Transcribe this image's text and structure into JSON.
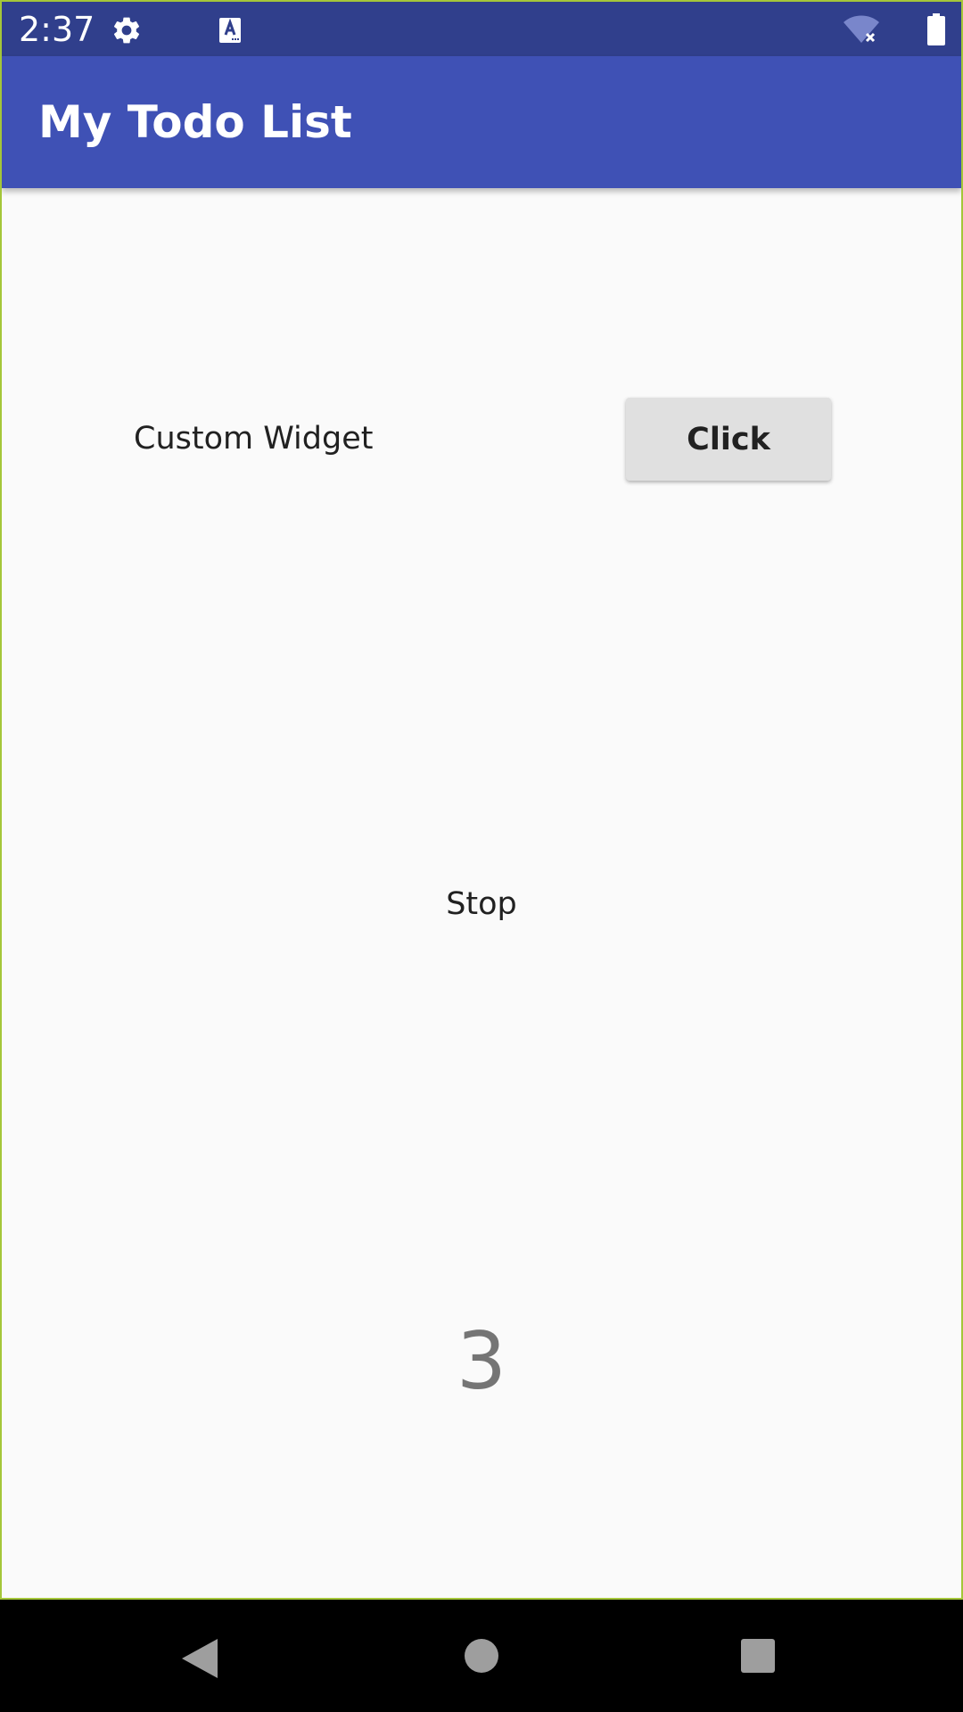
{
  "status_bar": {
    "time": "2:37",
    "icons": [
      "gear-icon",
      "keyboard-a-icon",
      "wifi-off-icon",
      "battery-icon"
    ],
    "color": "#303f8c"
  },
  "app_bar": {
    "title": "My Todo List",
    "color": "#3f51b5"
  },
  "content": {
    "label": "Custom Widget",
    "button_label": "Click",
    "stop_text": "Stop",
    "counter": "3"
  },
  "nav_bar": {
    "buttons": [
      "back-icon",
      "home-icon",
      "recents-icon"
    ]
  }
}
